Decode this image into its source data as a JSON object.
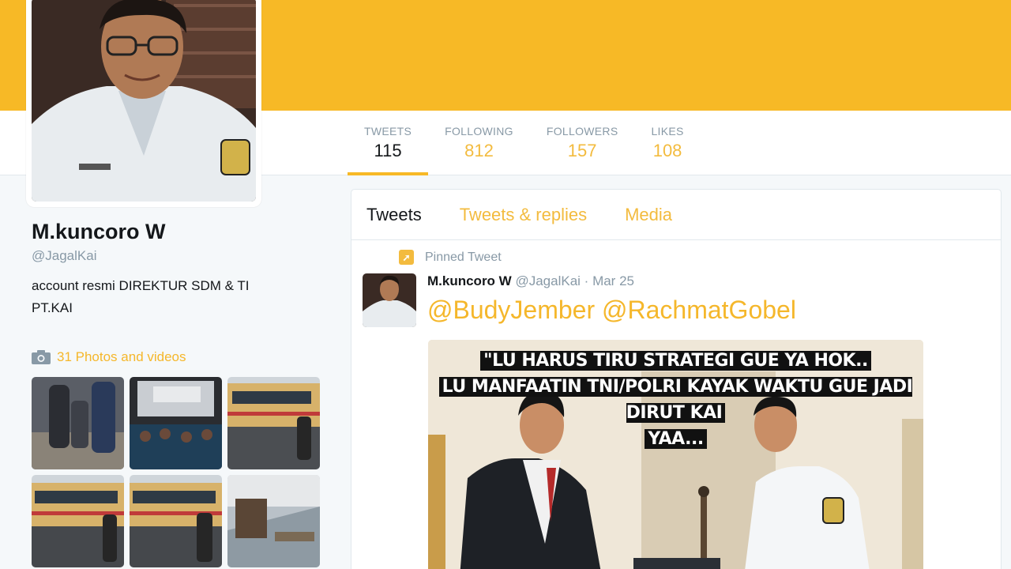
{
  "colors": {
    "accent": "#f7b926",
    "banner": "#f7b926",
    "link": "#f5b72b",
    "stat_value": "#f3bb3e",
    "text_dark": "#14171a",
    "text_muted": "#8899a6"
  },
  "profile": {
    "name": "M.kuncoro W",
    "handle": "@JagalKai",
    "bio_line1": "account resmi DIREKTUR SDM & TI",
    "bio_line2": "PT.KAI",
    "photos_label": "31 Photos and videos",
    "photos_icon": "camera-icon"
  },
  "stats": [
    {
      "label": "TWEETS",
      "value": "115"
    },
    {
      "label": "FOLLOWING",
      "value": "812"
    },
    {
      "label": "FOLLOWERS",
      "value": "157"
    },
    {
      "label": "LIKES",
      "value": "108"
    }
  ],
  "timeline": {
    "tabs": [
      "Tweets",
      "Tweets & replies",
      "Media"
    ],
    "pinned_label": "Pinned Tweet",
    "tweet": {
      "author": "M.kuncoro W",
      "handle": "@JagalKai",
      "sep": "·",
      "date": "Mar 25",
      "mention1": "@BudyJember",
      "mention2": "@RachmatGobel",
      "meme_line1": "\"LU HARUS TIRU STRATEGI GUE YA HOK..",
      "meme_line2": "LU MANFAATIN TNI/POLRI KAYAK WAKTU GUE JADI DIRUT KAI",
      "meme_line3": "YAA..."
    }
  }
}
